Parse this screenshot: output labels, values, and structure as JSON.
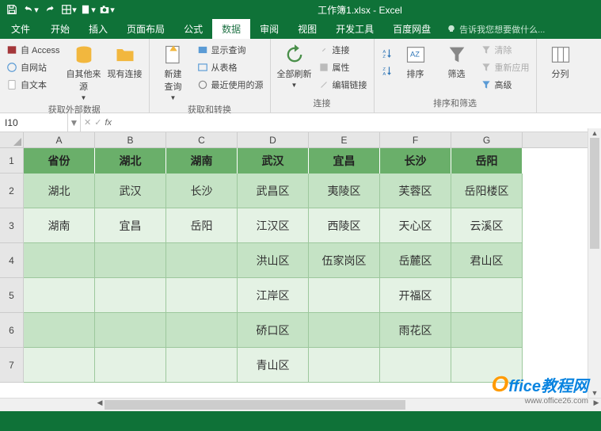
{
  "title": "工作簿1.xlsx - Excel",
  "qat": {
    "save": "保存",
    "undo": "撤销",
    "redo": "重做"
  },
  "tabs": {
    "file": "文件",
    "home": "开始",
    "insert": "插入",
    "layout": "页面布局",
    "formulas": "公式",
    "data": "数据",
    "review": "审阅",
    "view": "视图",
    "developer": "开发工具",
    "baidu": "百度网盘",
    "tellme": "告诉我您想要做什么..."
  },
  "ribbon": {
    "ext": {
      "access": "自 Access",
      "web": "自网站",
      "text": "自文本",
      "other": "自其他来源",
      "existing": "现有连接",
      "label": "获取外部数据"
    },
    "get": {
      "newquery": "新建\n查询",
      "showq": "显示查询",
      "fromtable": "从表格",
      "recent": "最近使用的源",
      "label": "获取和转换"
    },
    "conn": {
      "refresh": "全部刷新",
      "connections": "连接",
      "properties": "属性",
      "editlinks": "编辑链接",
      "label": "连接"
    },
    "sort": {
      "az": "升序",
      "za": "排序",
      "filter": "筛选",
      "clear": "清除",
      "reapply": "重新应用",
      "advanced": "高级",
      "label": "排序和筛选"
    },
    "tools": {
      "split": "分列"
    }
  },
  "namebox": "I10",
  "columns": [
    "A",
    "B",
    "C",
    "D",
    "E",
    "F",
    "G"
  ],
  "rows": [
    "1",
    "2",
    "3",
    "4",
    "5",
    "6",
    "7"
  ],
  "sheet": {
    "header": [
      "省份",
      "湖北",
      "湖南",
      "武汉",
      "宜昌",
      "长沙",
      "岳阳"
    ],
    "r2": [
      "湖北",
      "武汉",
      "长沙",
      "武昌区",
      "夷陵区",
      "芙蓉区",
      "岳阳楼区"
    ],
    "r3": [
      "湖南",
      "宜昌",
      "岳阳",
      "江汉区",
      "西陵区",
      "天心区",
      "云溪区"
    ],
    "r4": [
      "",
      "",
      "",
      "洪山区",
      "伍家岗区",
      "岳麓区",
      "君山区"
    ],
    "r5": [
      "",
      "",
      "",
      "江岸区",
      "",
      "开福区",
      ""
    ],
    "r6": [
      "",
      "",
      "",
      "硚口区",
      "",
      "雨花区",
      ""
    ],
    "r7": [
      "",
      "",
      "",
      "青山区",
      "",
      "",
      ""
    ]
  },
  "watermark": {
    "brand": "ffice教程网",
    "url": "www.office26.com"
  }
}
